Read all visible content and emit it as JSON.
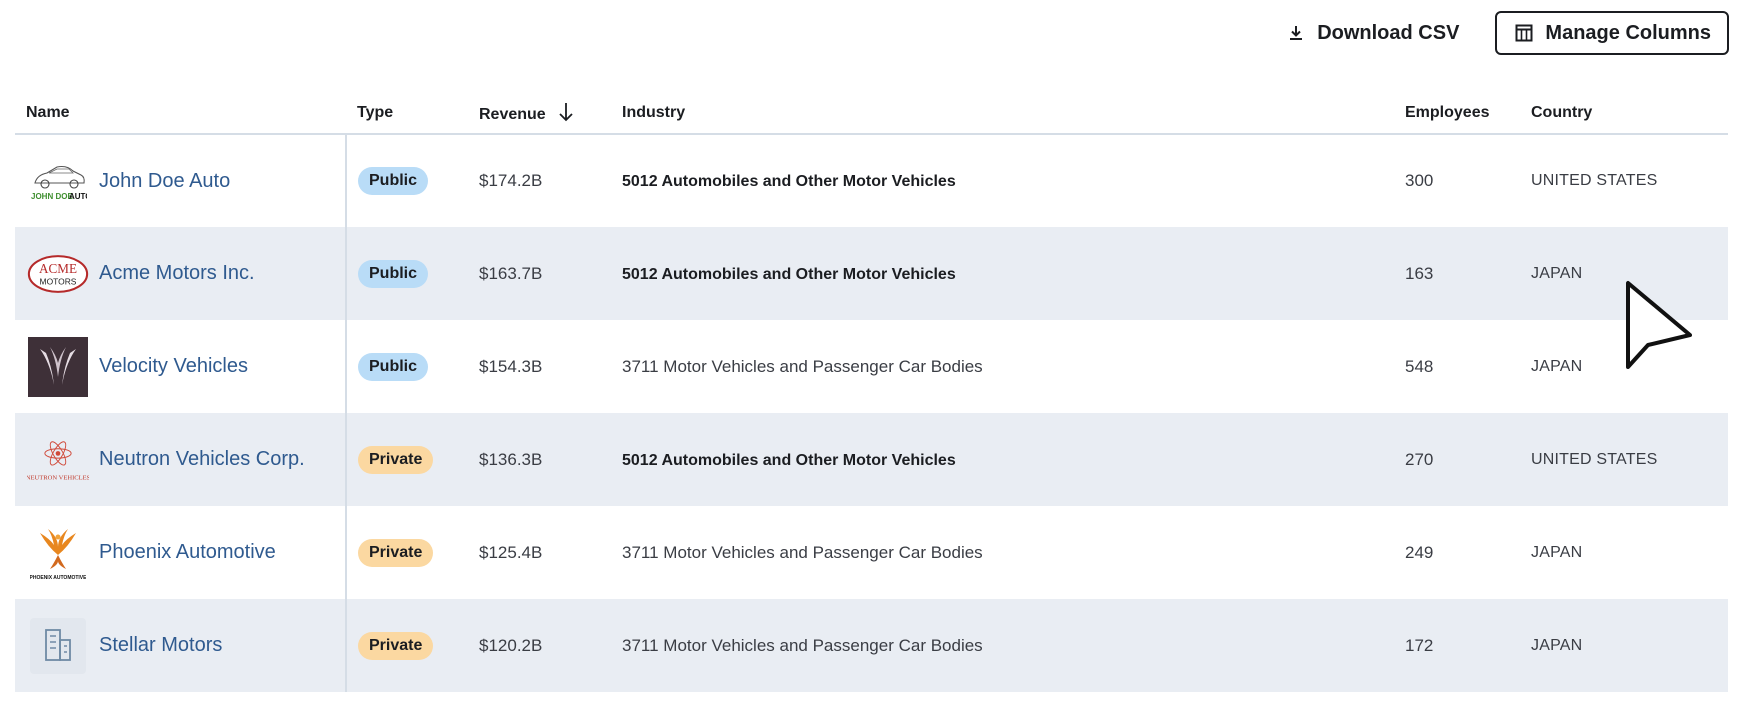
{
  "toolbar": {
    "download_label": "Download CSV",
    "manage_label": "Manage Columns"
  },
  "columns": {
    "name": "Name",
    "type": "Type",
    "revenue": "Revenue",
    "industry": "Industry",
    "employees": "Employees",
    "country": "Country",
    "sorted_by": "revenue",
    "sort_direction": "descending"
  },
  "rows": [
    {
      "name": "John Doe Auto",
      "logo": "john-doe-auto-logo",
      "logo_text": "JOHN DOE AUTO",
      "type": "Public",
      "revenue": "$174.2B",
      "industry": "5012 Automobiles and Other Motor Vehicles",
      "employees": "300",
      "country": "UNITED STATES"
    },
    {
      "name": "Acme Motors Inc.",
      "logo": "acme-motors-logo",
      "logo_text": "ACME MOTORS",
      "type": "Public",
      "revenue": "$163.7B",
      "industry": "5012 Automobiles and Other Motor Vehicles",
      "employees": "163",
      "country": "JAPAN"
    },
    {
      "name": "Velocity Vehicles",
      "logo": "velocity-vehicles-logo",
      "type": "Public",
      "revenue": "$154.3B",
      "industry": "3711 Motor Vehicles and Passenger Car Bodies",
      "employees": "548",
      "country": "JAPAN"
    },
    {
      "name": "Neutron Vehicles Corp.",
      "logo": "neutron-vehicles-logo",
      "logo_text": "NEUTRON VEHICLES",
      "type": "Private",
      "revenue": "$136.3B",
      "industry": "5012 Automobiles and Other Motor Vehicles",
      "employees": "270",
      "country": "UNITED STATES"
    },
    {
      "name": "Phoenix Automotive",
      "logo": "phoenix-automotive-logo",
      "logo_text": "PHOENIX AUTOMOTIVE",
      "type": "Private",
      "revenue": "$125.4B",
      "industry": "3711 Motor Vehicles and Passenger Car Bodies",
      "employees": "249",
      "country": "JAPAN"
    },
    {
      "name": "Stellar Motors",
      "logo": "building-icon",
      "type": "Private",
      "revenue": "$120.2B",
      "industry": "3711 Motor Vehicles and Passenger Car Bodies",
      "employees": "172",
      "country": "JAPAN"
    }
  ],
  "colors": {
    "link": "#2f5a8f",
    "public_badge": "#b9dcf7",
    "private_badge": "#fbd8a1",
    "stripe": "#e9edf3"
  }
}
